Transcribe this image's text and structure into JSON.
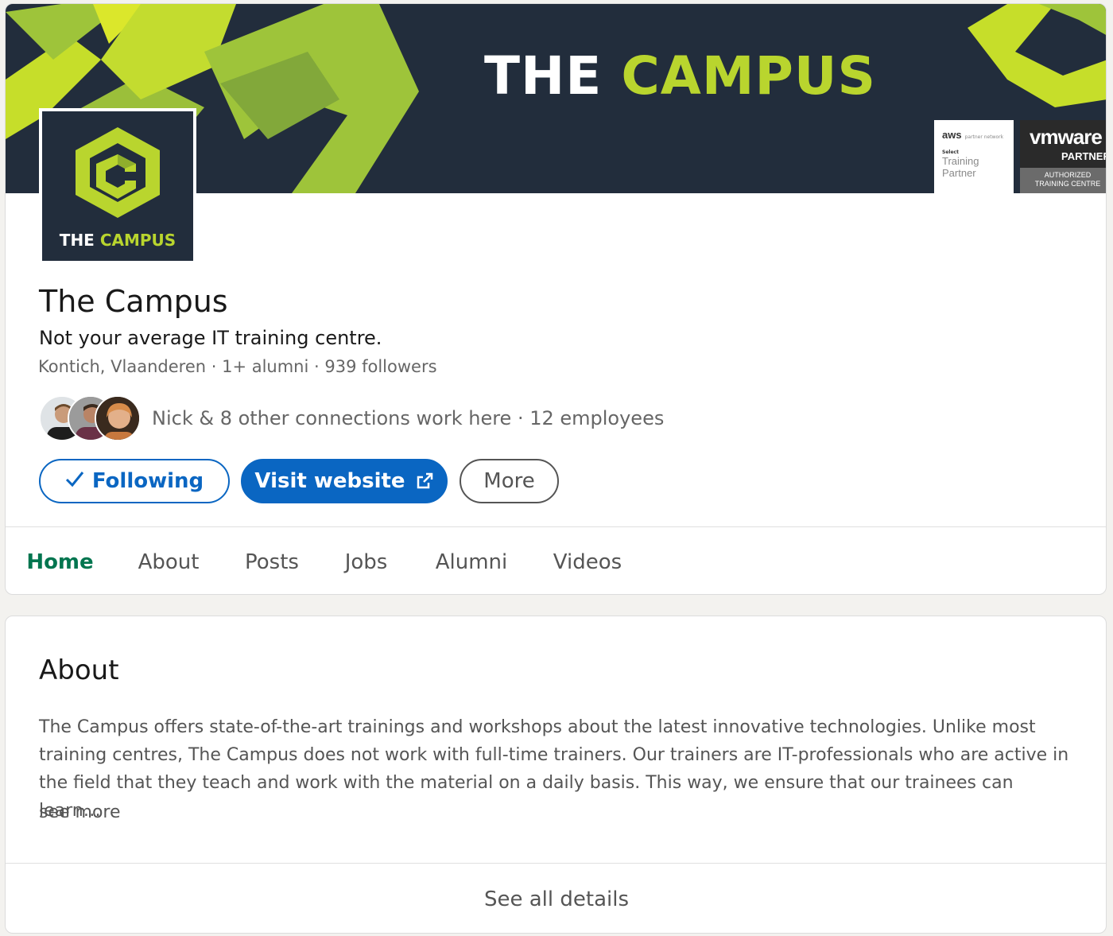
{
  "colors": {
    "brand_navy": "#222d3c",
    "brand_green": "#b9d52e",
    "linkedin_blue": "#0a66c2",
    "active_tab_green": "#01754f"
  },
  "banner": {
    "title_white": "THE",
    "title_green": "CAMPUS",
    "aws_badge": {
      "logo": "aws",
      "small": "partner network",
      "select": "Select",
      "line1": "Training",
      "line2": "Partner"
    },
    "vmware_badge": {
      "logo": "vmware",
      "partner": "PARTNER",
      "auth_line1": "AUTHORIZED",
      "auth_line2": "TRAINING CENTRE"
    }
  },
  "logo": {
    "text_white": "THE",
    "text_green": "CAMPUS",
    "icon": "hexagon-c-logo-icon"
  },
  "company": {
    "name": "The Campus",
    "tagline": "Not your average IT training centre.",
    "meta": "Kontich, Vlaanderen · 1+ alumni · 939 followers",
    "connections": "Nick & 8 other connections work here · 12 employees"
  },
  "actions": {
    "following_label": "Following",
    "following_icon": "checkmark-icon",
    "visit_label": "Visit website",
    "visit_icon": "external-link-icon",
    "more_label": "More"
  },
  "tabs": [
    {
      "label": "Home",
      "active": true
    },
    {
      "label": "About",
      "active": false
    },
    {
      "label": "Posts",
      "active": false
    },
    {
      "label": "Jobs",
      "active": false
    },
    {
      "label": "Alumni",
      "active": false
    },
    {
      "label": "Videos",
      "active": false
    }
  ],
  "about": {
    "title": "About",
    "text": "The Campus offers state-of-the-art trainings and workshops about the latest innovative technologies. Unlike most training centres, The Campus does not work with full-time trainers. Our trainers are IT-professionals who are active in the field that they teach and work with the material on a daily basis. This way, we ensure that our trainees can learn…",
    "see_more": "see more",
    "footer": "See all details"
  }
}
